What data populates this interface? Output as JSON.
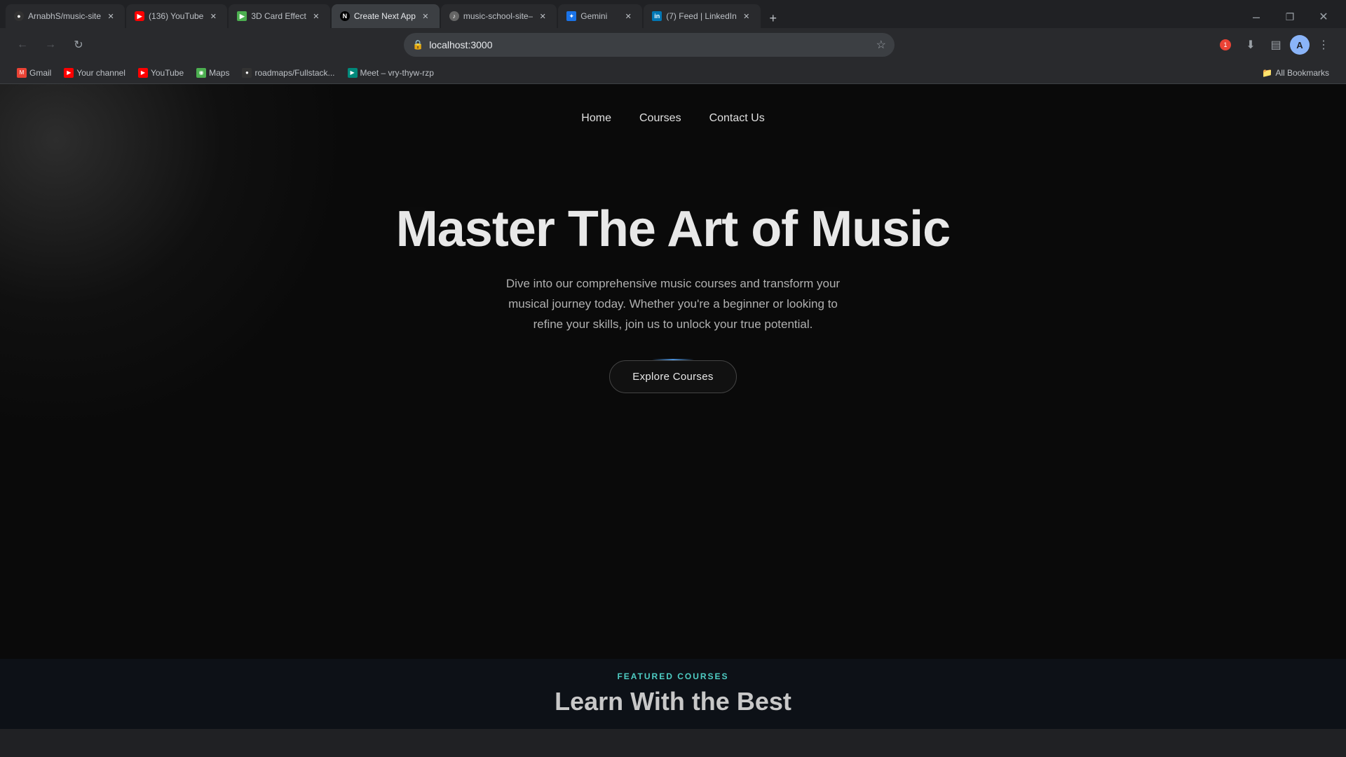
{
  "browser": {
    "tabs": [
      {
        "id": "tab-github",
        "title": "ArnabhS/music-site",
        "favicon_type": "gh",
        "favicon_text": "●",
        "active": false
      },
      {
        "id": "tab-youtube",
        "title": "(136) YouTube",
        "favicon_type": "yt",
        "favicon_text": "▶",
        "active": false
      },
      {
        "id": "tab-3d",
        "title": "3D Card Effect",
        "favicon_type": "green",
        "favicon_text": "▶",
        "active": false
      },
      {
        "id": "tab-next",
        "title": "Create Next App",
        "favicon_type": "next",
        "favicon_text": "N",
        "active": true
      },
      {
        "id": "tab-music",
        "title": "music-school-site–",
        "favicon_type": "gray",
        "favicon_text": "♪",
        "active": false
      },
      {
        "id": "tab-gemini",
        "title": "Gemini",
        "favicon_type": "gem",
        "favicon_text": "✦",
        "active": false
      },
      {
        "id": "tab-linkedin",
        "title": "(7) Feed | LinkedIn",
        "favicon_type": "li",
        "favicon_text": "in",
        "active": false
      }
    ],
    "url": "localhost:3000",
    "bookmarks": [
      {
        "label": "Gmail",
        "favicon": "M",
        "favicon_bg": "#ea4335"
      },
      {
        "label": "Your channel",
        "favicon": "▶",
        "favicon_bg": "#ff0000"
      },
      {
        "label": "YouTube",
        "favicon": "▶",
        "favicon_bg": "#ff0000"
      },
      {
        "label": "Maps",
        "favicon": "◉",
        "favicon_bg": "#4caf50"
      },
      {
        "label": "roadmaps/Fullstack...",
        "favicon": "●",
        "favicon_bg": "#333"
      },
      {
        "label": "Meet – vry-thyw-rzp",
        "favicon": "▶",
        "favicon_bg": "#00897b"
      }
    ],
    "all_bookmarks_label": "All Bookmarks"
  },
  "site": {
    "nav": {
      "links": [
        {
          "label": "Home"
        },
        {
          "label": "Courses"
        },
        {
          "label": "Contact Us"
        }
      ]
    },
    "hero": {
      "title": "Master The Art of Music",
      "subtitle": "Dive into our comprehensive music courses and transform your musical journey today. Whether you're a beginner or looking to refine your skills, join us to unlock your true potential.",
      "cta_label": "Explore Courses"
    },
    "featured": {
      "label": "FEATURED COURSES",
      "title": "Learn With the Best"
    }
  }
}
